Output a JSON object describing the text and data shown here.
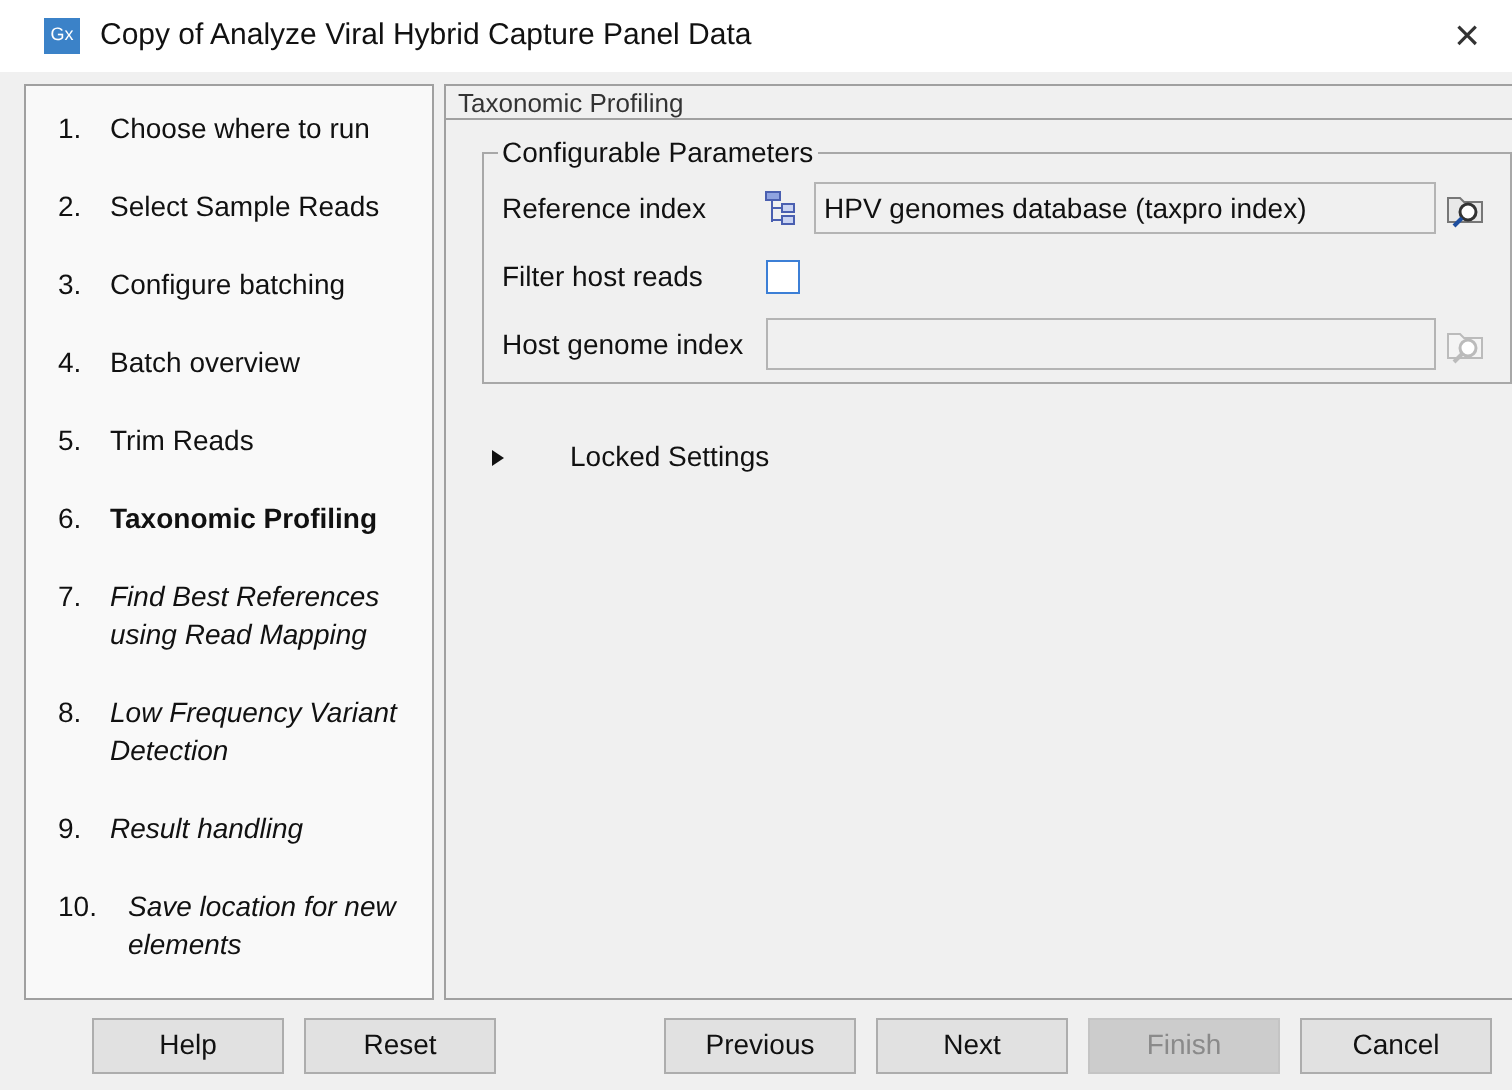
{
  "window": {
    "title": "Copy of Analyze Viral Hybrid Capture Panel Data",
    "app_icon": "Gx",
    "close": "×"
  },
  "steps": [
    {
      "number": "1.",
      "label": "Choose where to run",
      "kind": "done"
    },
    {
      "number": "2.",
      "label": "Select Sample Reads",
      "kind": "done"
    },
    {
      "number": "3.",
      "label": "Configure batching",
      "kind": "done"
    },
    {
      "number": "4.",
      "label": "Batch overview",
      "kind": "done"
    },
    {
      "number": "5.",
      "label": "Trim Reads",
      "kind": "done"
    },
    {
      "number": "6.",
      "label": "Taxonomic Profiling",
      "kind": "current"
    },
    {
      "number": "7.",
      "label": "Find Best References using Read Mapping",
      "kind": "upcoming"
    },
    {
      "number": "8.",
      "label": "Low Frequency Variant Detection",
      "kind": "upcoming"
    },
    {
      "number": "9.",
      "label": "Result handling",
      "kind": "upcoming"
    },
    {
      "number": "10.",
      "label": "Save location for new elements",
      "kind": "upcoming"
    }
  ],
  "panel": {
    "title": "Taxonomic Profiling",
    "group": "Configurable Parameters",
    "fields": [
      {
        "kind": "file",
        "label": "Reference index",
        "value": "HPV genomes database (taxpro index)",
        "disabled": false
      },
      {
        "kind": "checkbox",
        "label": "Filter host reads",
        "checked": false
      },
      {
        "kind": "file",
        "label": "Host genome index",
        "disabled": true
      }
    ],
    "locked": {
      "label": "Locked Settings",
      "expanded": false
    }
  },
  "buttons_left": [
    {
      "label": "Help",
      "disabled": false
    },
    {
      "label": "Reset",
      "disabled": false
    }
  ],
  "buttons_right": [
    {
      "label": "Previous",
      "disabled": false
    },
    {
      "label": "Next",
      "disabled": false
    },
    {
      "label": "Finish",
      "disabled": true
    },
    {
      "label": "Cancel",
      "disabled": false
    }
  ]
}
